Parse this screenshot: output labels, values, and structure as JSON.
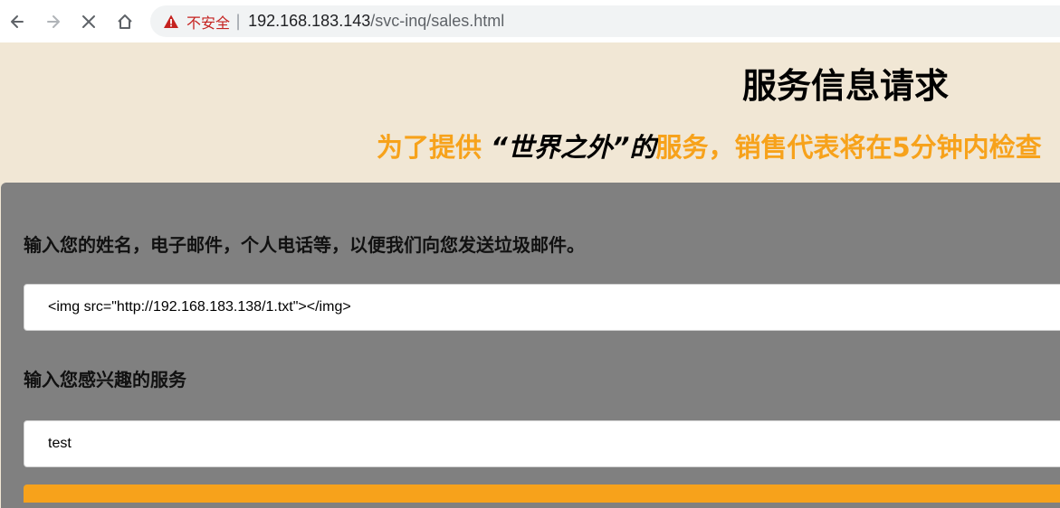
{
  "browser": {
    "security_label": "不安全",
    "separator": "|",
    "url_host": "192.168.183.143",
    "url_path": "/svc-inq/sales.html"
  },
  "header": {
    "title": "服务信息请求",
    "subtitle_before": "为了提供",
    "subtitle_quote": "“世界之外”的",
    "subtitle_after": "服务，销售代表将在5分钟内检查"
  },
  "form": {
    "contact_label": "输入您的姓名，电子邮件，个人电话等，以便我们向您发送垃圾邮件。",
    "contact_value": "<img src=\"http://192.168.183.138/1.txt\"></img>",
    "service_label": "输入您感兴趣的服务",
    "service_value": "test"
  }
}
